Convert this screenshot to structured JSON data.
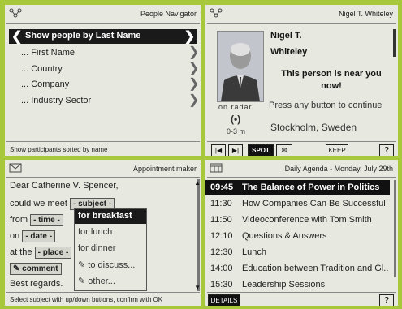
{
  "navigator": {
    "title": "People Navigator",
    "selected": "Show people by Last Name",
    "items": [
      "... First Name",
      "... Country",
      "... Company",
      "... Industry Sector"
    ],
    "footer": "Show participants sorted by name"
  },
  "person": {
    "title": "Nigel T. Whiteley",
    "first": "Nigel T.",
    "last": "Whiteley",
    "near": "This person is near you now!",
    "prompt": "Press any button to continue",
    "location": "Stockholm, Sweden",
    "radar": "on radar",
    "distance": "0-3 m",
    "spot": "SPOT",
    "keep": "KEEP",
    "help": "?"
  },
  "appointment": {
    "title": "Appointment maker",
    "l1": "Dear Catherine V. Spencer,",
    "l2a": "could we meet",
    "subject": "- subject -",
    "l3a": "from",
    "time": "- time -",
    "l4a": "on",
    "date": "- date -",
    "l5a": "at the",
    "place": "- place -",
    "comment": "comment",
    "closing": "Best regards.",
    "options": [
      "for breakfast",
      "for lunch",
      "for dinner",
      "to discuss...",
      "other..."
    ],
    "footer": "Select subject with up/down buttons, confirm with OK"
  },
  "agenda": {
    "title": "Daily Agenda - Monday, July 29th",
    "rows": [
      {
        "time": "09:45",
        "title": "The Balance of Power in Politics"
      },
      {
        "time": "11:30",
        "title": "How Companies Can Be Successful ..."
      },
      {
        "time": "11:50",
        "title": "Videoconference with Tom Smith"
      },
      {
        "time": "12:10",
        "title": "Questions & Answers"
      },
      {
        "time": "12:30",
        "title": "Lunch"
      },
      {
        "time": "14:00",
        "title": "Education between Tradition and Gl..."
      },
      {
        "time": "15:30",
        "title": "Leadership Sessions"
      }
    ],
    "details": "DETAILS",
    "help": "?"
  }
}
